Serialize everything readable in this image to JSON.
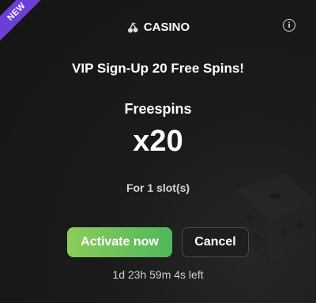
{
  "badge": {
    "label": "NEW"
  },
  "header": {
    "category_label": "CASINO",
    "category_icon": "cherry-icon",
    "info_icon": "info-icon"
  },
  "promo": {
    "title": "VIP Sign-Up 20 Free Spins!",
    "reward_label": "Freespins",
    "reward_value": "x20",
    "reward_scope": "For 1 slot(s)"
  },
  "actions": {
    "activate_label": "Activate now",
    "cancel_label": "Cancel"
  },
  "timer": {
    "text": "1d 23h 59m 4s left"
  },
  "colors": {
    "background": "#151515",
    "badge": "#6b3fd6",
    "activate_start": "#8ccc5a",
    "activate_end": "#4fb85c"
  }
}
